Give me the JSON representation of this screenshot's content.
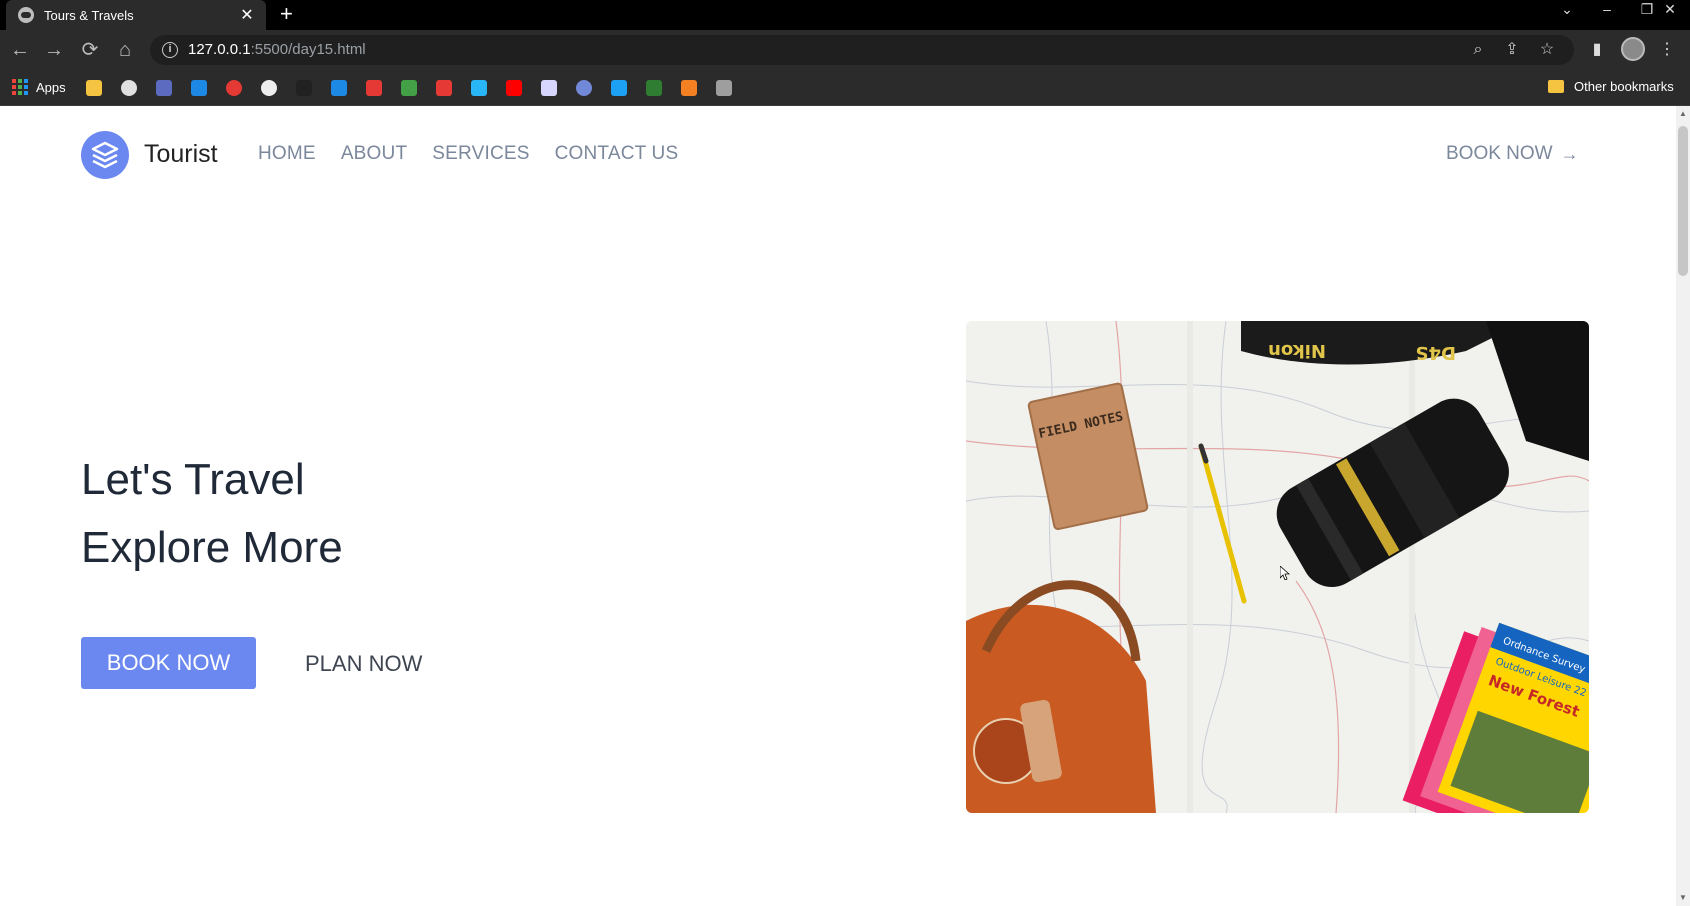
{
  "browser": {
    "tab_title": "Tours & Travels",
    "tab_close": "✕",
    "new_tab": "+",
    "url_host": "127.0.0.1",
    "url_rest": ":5500/day15.html",
    "apps_label": "Apps",
    "other_bookmarks_label": "Other bookmarks",
    "bookmark_icons": [
      "notes-icon",
      "globe-icon",
      "code-icon",
      "c-icon",
      "rainbow-icon",
      "google-icon",
      "hashnode-icon",
      "linkedin-icon",
      "gmail-icon",
      "maps-icon",
      "acrobat-icon",
      "translate-icon",
      "youtube-icon",
      "kite-icon",
      "discord-icon",
      "twitter-icon",
      "w-icon",
      "stackoverflow-icon",
      "ribbon-icon"
    ],
    "bookmark_colors": [
      "#f5c542",
      "#e0e0e0",
      "#5c6bc0",
      "#1e88e5",
      "#e53935",
      "#eeeeee",
      "#212121",
      "#1e88e5",
      "#e53935",
      "#43a047",
      "#e53935",
      "#29b6f6",
      "#ff0000",
      "#d6d6ff",
      "#7289da",
      "#1da1f2",
      "#2e7d32",
      "#f48024",
      "#9e9e9e"
    ]
  },
  "site": {
    "brand": "Tourist",
    "brand_color": "#6b88f0",
    "nav": [
      "HOME",
      "ABOUT",
      "SERVICES",
      "CONTACT US"
    ],
    "header_cta": "BOOK NOW",
    "header_cta_arrow": "→"
  },
  "hero": {
    "title_line1": "Let's Travel",
    "title_line2": "Explore More",
    "primary_button": "BOOK NOW",
    "secondary_button": "PLAN NOW",
    "image_text": {
      "notebook": "FIELD NOTES",
      "strap_left": "Nikon",
      "strap_right": "D4S",
      "map_title": "New Forest",
      "map_sub": "Outdoor Leisure 22",
      "map_brand": "Ordnance Survey"
    }
  }
}
